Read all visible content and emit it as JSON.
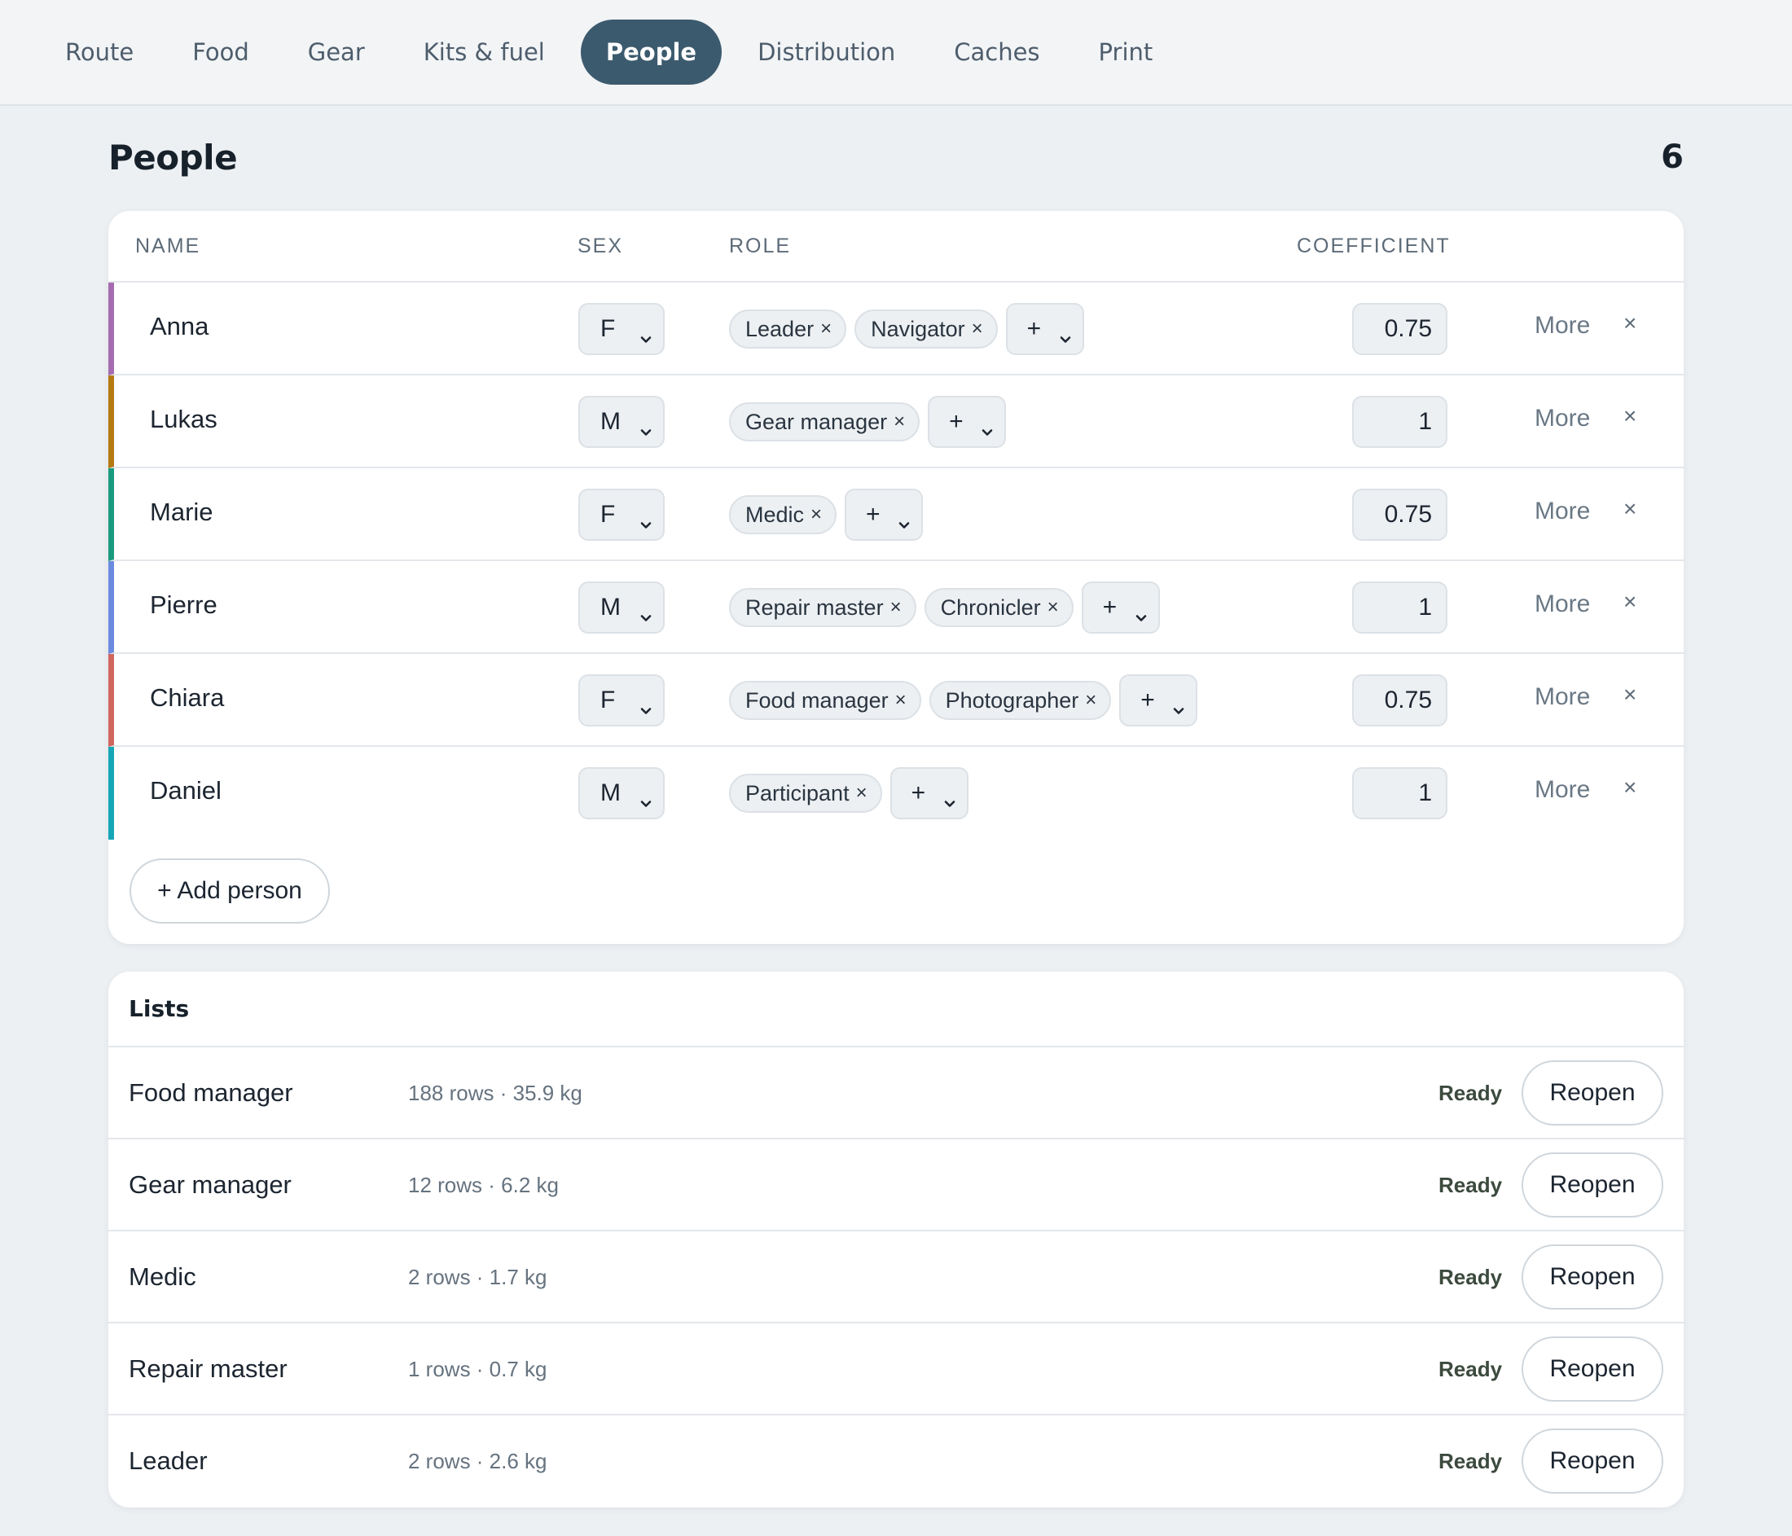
{
  "nav": {
    "tabs": [
      {
        "label": "Route"
      },
      {
        "label": "Food"
      },
      {
        "label": "Gear"
      },
      {
        "label": "Kits & fuel"
      },
      {
        "label": "People",
        "active": true
      },
      {
        "label": "Distribution"
      },
      {
        "label": "Caches"
      },
      {
        "label": "Print"
      }
    ]
  },
  "people": {
    "title": "People",
    "count": "6",
    "columns": {
      "name": "NAME",
      "sex": "SEX",
      "role": "ROLE",
      "coefficient": "COEFFICIENT"
    },
    "rows": [
      {
        "name": "Anna",
        "sex": "F",
        "roles": [
          "Leader",
          "Navigator"
        ],
        "coefficient": "0.75",
        "color": "#a56cb0"
      },
      {
        "name": "Lukas",
        "sex": "M",
        "roles": [
          "Gear manager"
        ],
        "coefficient": "1",
        "color": "#b57a12"
      },
      {
        "name": "Marie",
        "sex": "F",
        "roles": [
          "Medic"
        ],
        "coefficient": "0.75",
        "color": "#1a9a7e"
      },
      {
        "name": "Pierre",
        "sex": "M",
        "roles": [
          "Repair master",
          "Chronicler"
        ],
        "coefficient": "1",
        "color": "#6b8be0"
      },
      {
        "name": "Chiara",
        "sex": "F",
        "roles": [
          "Food manager",
          "Photographer"
        ],
        "coefficient": "0.75",
        "color": "#d0675e"
      },
      {
        "name": "Daniel",
        "sex": "M",
        "roles": [
          "Participant"
        ],
        "coefficient": "1",
        "color": "#16a6b6"
      }
    ],
    "more_label": "More",
    "delete_glyph": "×",
    "chip_remove_glyph": "×",
    "add_role_glyph": "+",
    "add_person_label": "+ Add person"
  },
  "lists": {
    "title": "Lists",
    "rows": [
      {
        "name": "Food manager",
        "meta": "188 rows · 35.9 kg",
        "status": "Ready",
        "action": "Reopen"
      },
      {
        "name": "Gear manager",
        "meta": "12 rows · 6.2 kg",
        "status": "Ready",
        "action": "Reopen"
      },
      {
        "name": "Medic",
        "meta": "2 rows · 1.7 kg",
        "status": "Ready",
        "action": "Reopen"
      },
      {
        "name": "Repair master",
        "meta": "1 rows · 0.7 kg",
        "status": "Ready",
        "action": "Reopen"
      },
      {
        "name": "Leader",
        "meta": "2 rows · 2.6 kg",
        "status": "Ready",
        "action": "Reopen"
      }
    ]
  },
  "icons": {
    "dropdown": "chevron-down-icon",
    "remove": "close-icon"
  },
  "colors": {
    "accent": "#3c5a6e",
    "background": "#edf0f3"
  }
}
